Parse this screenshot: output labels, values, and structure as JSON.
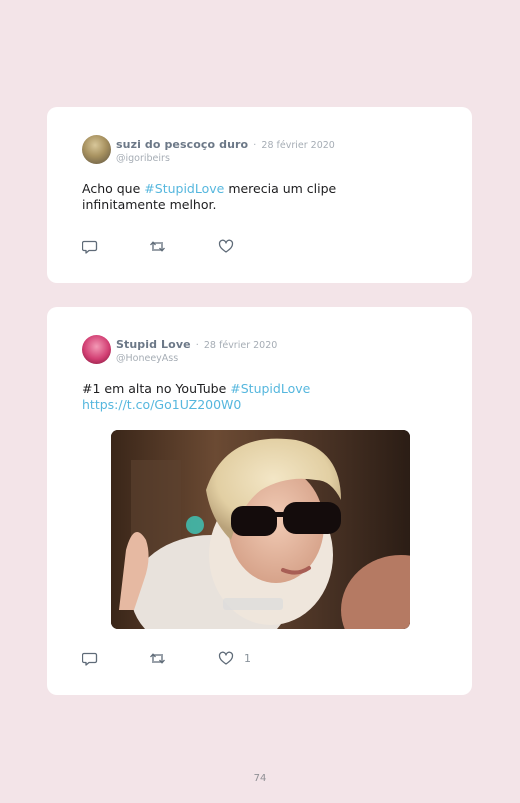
{
  "tweets": [
    {
      "author_name": "suzi do pescoço duro",
      "separator": "·",
      "date": "28 février 2020",
      "handle": "@igoribeirs",
      "text_before": "Acho que ",
      "hashtag": "#StupidLove",
      "text_after": " merecia um clipe infinitamente melhor."
    },
    {
      "author_name": "Stupid Love",
      "separator": "·",
      "date": "28 février 2020",
      "handle": "@HoneeyAss",
      "text_before": "#1 em alta no YouTube ",
      "hashtag": "#StupidLove",
      "link": "https://t.co/Go1UZ200W0",
      "like_count": "1"
    }
  ],
  "icons": {
    "reply": "reply-icon",
    "retweet": "retweet-icon",
    "like": "heart-icon"
  },
  "colors": {
    "background": "#f3e4e8",
    "card": "#ffffff",
    "accent": "#56b7de",
    "muted": "#a6adb5"
  },
  "page_number": "74"
}
